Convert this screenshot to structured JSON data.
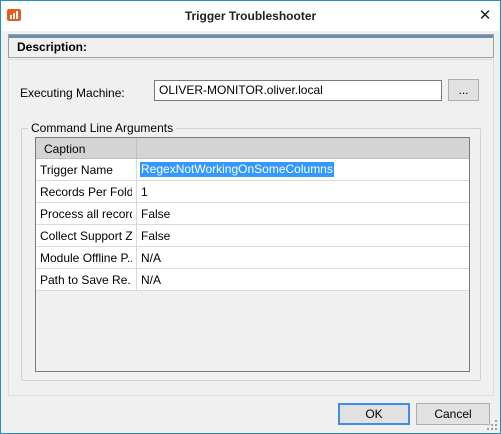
{
  "window": {
    "title": "Trigger Troubleshooter",
    "close_glyph": "✕",
    "app_icon": "app-logo-icon"
  },
  "description": {
    "label": "Description:"
  },
  "machine": {
    "label": "Executing Machine:",
    "value": "OLIVER-MONITOR.oliver.local",
    "browse_label": "..."
  },
  "arguments": {
    "group_label": "Command Line Arguments",
    "header_caption": "Caption",
    "rows": [
      {
        "name": "Trigger Name",
        "value": "RegexNotWorkingOnSomeColumns"
      },
      {
        "name": "Records Per Folder",
        "value": "1"
      },
      {
        "name": "Process all records",
        "value": "False"
      },
      {
        "name": "Collect Support ZIP",
        "value": "False"
      },
      {
        "name": "Module Offline P...",
        "value": "N/A"
      },
      {
        "name": "Path to Save Re...",
        "value": "N/A"
      }
    ]
  },
  "buttons": {
    "ok": "OK",
    "cancel": "Cancel"
  },
  "colors": {
    "accent": "#3399ff",
    "border": "#2b8fb8",
    "icon": "#e85a1e"
  }
}
